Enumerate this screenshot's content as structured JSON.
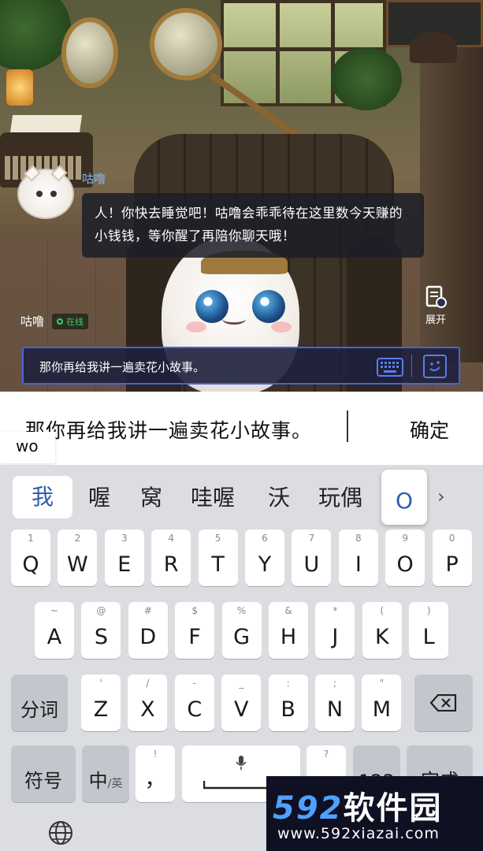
{
  "scene": {
    "speaker_name": "咕噜",
    "speech": "人！你快去睡觉吧！咕噜会乖乖待在这里数今天赚的小钱钱，等你醒了再陪你聊天哦！",
    "status_name": "咕噜",
    "status_online": "在线",
    "expand_label": "展开",
    "chat_input": "那你再给我讲一遍卖花小故事。"
  },
  "input_line": {
    "text": "那你再给我讲一遍卖花小故事。",
    "confirm": "确定",
    "pinyin": "wo"
  },
  "candidates": [
    "我",
    "喔",
    "窝",
    "哇喔",
    "沃",
    "玩偶"
  ],
  "key_popup": "O",
  "keys": {
    "row1": [
      {
        "main": "Q",
        "sub": "1"
      },
      {
        "main": "W",
        "sub": "2"
      },
      {
        "main": "E",
        "sub": "3"
      },
      {
        "main": "R",
        "sub": "4"
      },
      {
        "main": "T",
        "sub": "5"
      },
      {
        "main": "Y",
        "sub": "6"
      },
      {
        "main": "U",
        "sub": "7"
      },
      {
        "main": "I",
        "sub": "8"
      },
      {
        "main": "O",
        "sub": "9"
      },
      {
        "main": "P",
        "sub": "0"
      }
    ],
    "row2": [
      {
        "main": "A",
        "sub": "~"
      },
      {
        "main": "S",
        "sub": "@"
      },
      {
        "main": "D",
        "sub": "#"
      },
      {
        "main": "F",
        "sub": "$"
      },
      {
        "main": "G",
        "sub": "%"
      },
      {
        "main": "H",
        "sub": "&"
      },
      {
        "main": "J",
        "sub": "*"
      },
      {
        "main": "K",
        "sub": "("
      },
      {
        "main": "L",
        "sub": ")"
      }
    ],
    "row3": [
      {
        "main": "Z",
        "sub": "'"
      },
      {
        "main": "X",
        "sub": "/"
      },
      {
        "main": "C",
        "sub": "-"
      },
      {
        "main": "V",
        "sub": "_"
      },
      {
        "main": "B",
        "sub": ":"
      },
      {
        "main": "N",
        "sub": ";"
      },
      {
        "main": "M",
        "sub": "\""
      }
    ],
    "segment": "分词",
    "symbols": "符号",
    "lang_main": "中",
    "lang_sub": "/英",
    "comma": "，",
    "comma_sub": "!",
    "question_sub": "?",
    "num_key": "123",
    "done": "完成"
  },
  "watermark": {
    "num": "592",
    "cn": "软件园",
    "url": "www.592xiazai.com"
  },
  "colors": {
    "accent_blue": "#2f5fb0",
    "chat_border": "#4a62d8",
    "online_green": "#37d26f"
  }
}
